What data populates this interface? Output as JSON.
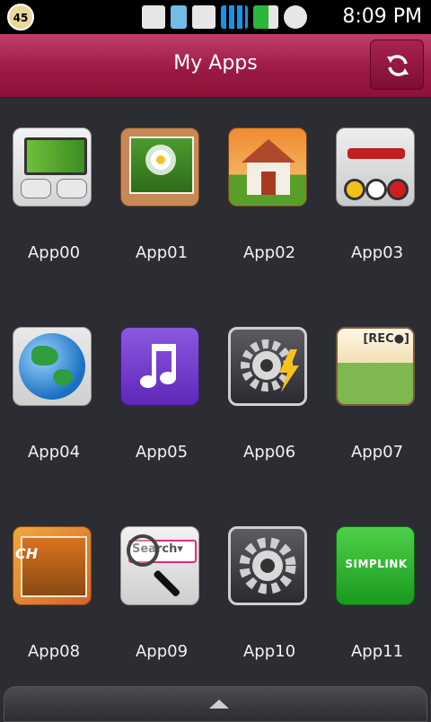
{
  "status_bar": {
    "notification_count": "45",
    "time": "8:09 PM",
    "icons": [
      "notification-badge-icon",
      "gallery-icon",
      "phone-icon",
      "data-transfer-icon",
      "signal-3g-icon",
      "battery-icon",
      "alarm-icon"
    ]
  },
  "header": {
    "title": "My Apps",
    "refresh_icon": "refresh-icon"
  },
  "apps": [
    {
      "label": "App00",
      "icon": "tv-gamepads-icon"
    },
    {
      "label": "App01",
      "icon": "photo-frame-icon"
    },
    {
      "label": "App02",
      "icon": "home-icon"
    },
    {
      "label": "App03",
      "icon": "av-cable-icon"
    },
    {
      "label": "App04",
      "icon": "globe-icon"
    },
    {
      "label": "App05",
      "icon": "music-note-icon"
    },
    {
      "label": "App06",
      "icon": "gear-bolt-icon"
    },
    {
      "label": "App07",
      "icon": "recorder-icon"
    },
    {
      "label": "App08",
      "icon": "channel-icon"
    },
    {
      "label": "App09",
      "icon": "search-magnifier-icon"
    },
    {
      "label": "App10",
      "icon": "gear-icon"
    },
    {
      "label": "App11",
      "icon": "simplink-icon"
    }
  ],
  "icon_texts": {
    "recorder": "[REC●]",
    "channel": "CH",
    "search": "Search▾",
    "simplink": "SIMPLINK"
  },
  "bottom_bar": {
    "arrow_icon": "chevron-up-icon"
  }
}
